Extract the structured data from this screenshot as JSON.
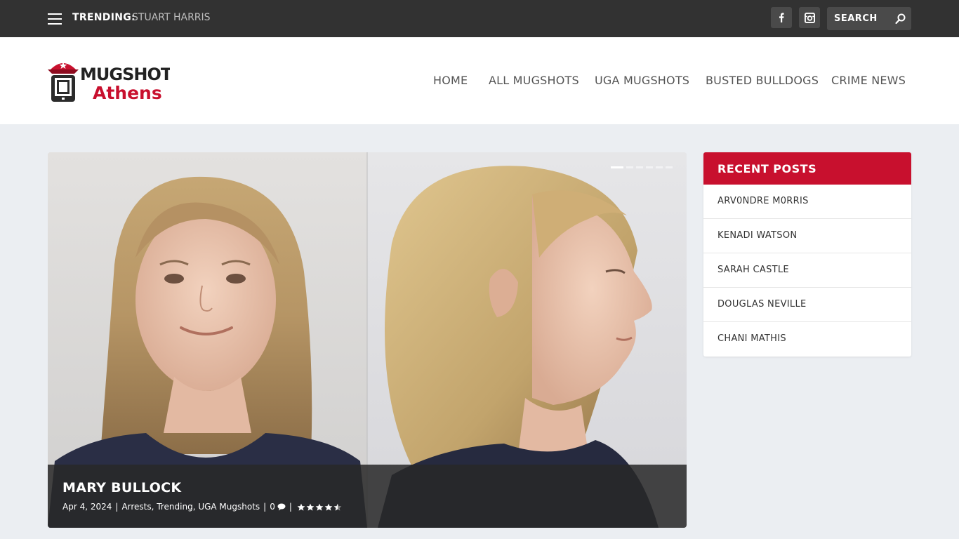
{
  "topbar": {
    "trending_label": "TRENDING:",
    "trending_link": "STUART HARRIS",
    "search_placeholder": "SEARCH",
    "icons": [
      "hamburger-menu-icon",
      "facebook-icon",
      "instagram-icon",
      "search-icon"
    ]
  },
  "logo": {
    "line1": "MUGSHOTS",
    "line2": "Athens"
  },
  "nav": {
    "items": [
      "HOME",
      "ALL MUGSHOTS",
      "UGA MUGSHOTS",
      "BUSTED BULLDOGS",
      "CRIME NEWS"
    ]
  },
  "featured": {
    "title": "MARY BULLOCK",
    "date": "Apr 4, 2024",
    "categories": [
      "Arrests",
      "Trending",
      "UGA Mugshots"
    ],
    "comments": "0",
    "rating": 4.5,
    "slide_count": 6,
    "active_slide": 1
  },
  "sidebar": {
    "title": "RECENT POSTS",
    "posts": [
      "ARV0NDRE M0RRIS",
      "KENADI WATSON",
      "SARAH CASTLE",
      "DOUGLAS NEVILLE",
      "CHANI MATHIS"
    ]
  },
  "colors": {
    "topbar": "#323232",
    "accent_red": "#c8102e",
    "background": "#ebeef2"
  }
}
